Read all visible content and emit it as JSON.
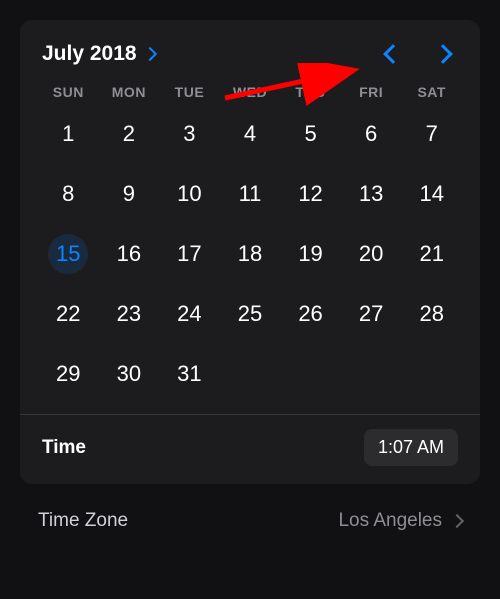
{
  "header": {
    "month_label": "July 2018"
  },
  "weekdays": [
    "SUN",
    "MON",
    "TUE",
    "WED",
    "THU",
    "FRI",
    "SAT"
  ],
  "days": [
    1,
    2,
    3,
    4,
    5,
    6,
    7,
    8,
    9,
    10,
    11,
    12,
    13,
    14,
    15,
    16,
    17,
    18,
    19,
    20,
    21,
    22,
    23,
    24,
    25,
    26,
    27,
    28,
    29,
    30,
    31
  ],
  "selected_day": 15,
  "time": {
    "label": "Time",
    "value": "1:07 AM"
  },
  "timezone": {
    "label": "Time Zone",
    "value": "Los Angeles"
  }
}
